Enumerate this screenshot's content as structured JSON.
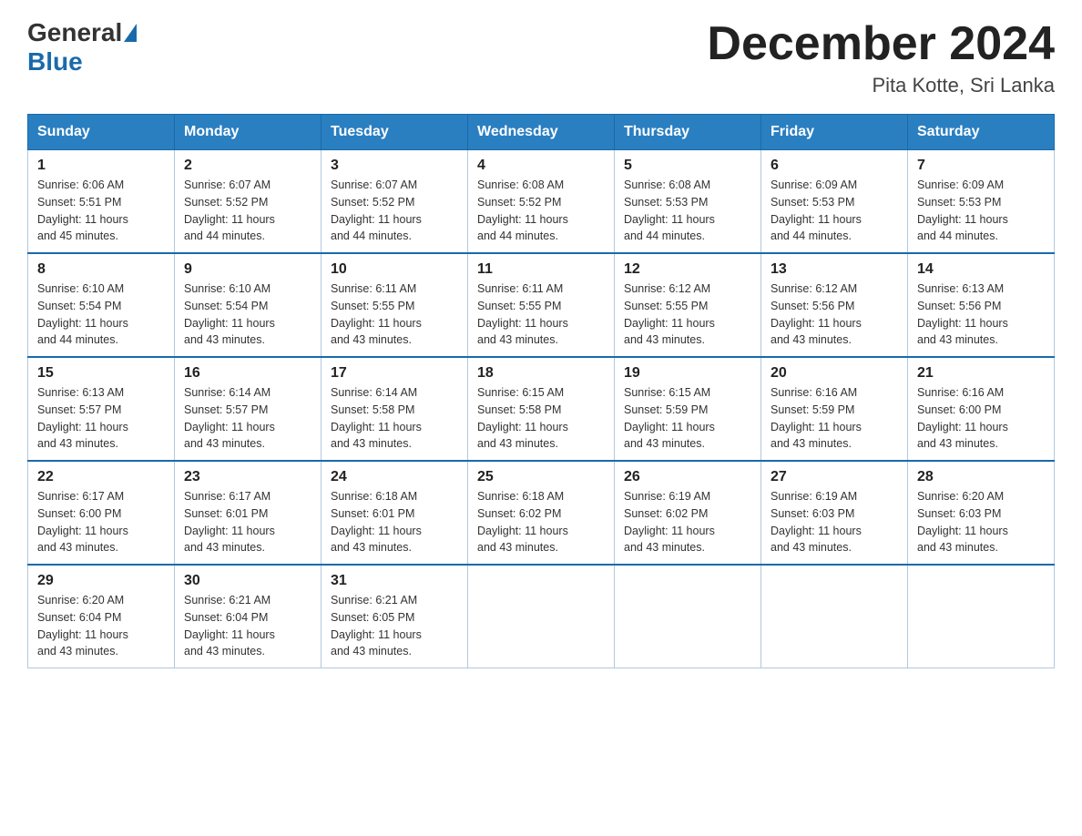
{
  "logo": {
    "general": "General",
    "blue": "Blue"
  },
  "title": "December 2024",
  "location": "Pita Kotte, Sri Lanka",
  "days_of_week": [
    "Sunday",
    "Monday",
    "Tuesday",
    "Wednesday",
    "Thursday",
    "Friday",
    "Saturday"
  ],
  "weeks": [
    [
      {
        "day": "1",
        "sunrise": "6:06 AM",
        "sunset": "5:51 PM",
        "daylight": "11 hours and 45 minutes."
      },
      {
        "day": "2",
        "sunrise": "6:07 AM",
        "sunset": "5:52 PM",
        "daylight": "11 hours and 44 minutes."
      },
      {
        "day": "3",
        "sunrise": "6:07 AM",
        "sunset": "5:52 PM",
        "daylight": "11 hours and 44 minutes."
      },
      {
        "day": "4",
        "sunrise": "6:08 AM",
        "sunset": "5:52 PM",
        "daylight": "11 hours and 44 minutes."
      },
      {
        "day": "5",
        "sunrise": "6:08 AM",
        "sunset": "5:53 PM",
        "daylight": "11 hours and 44 minutes."
      },
      {
        "day": "6",
        "sunrise": "6:09 AM",
        "sunset": "5:53 PM",
        "daylight": "11 hours and 44 minutes."
      },
      {
        "day": "7",
        "sunrise": "6:09 AM",
        "sunset": "5:53 PM",
        "daylight": "11 hours and 44 minutes."
      }
    ],
    [
      {
        "day": "8",
        "sunrise": "6:10 AM",
        "sunset": "5:54 PM",
        "daylight": "11 hours and 44 minutes."
      },
      {
        "day": "9",
        "sunrise": "6:10 AM",
        "sunset": "5:54 PM",
        "daylight": "11 hours and 43 minutes."
      },
      {
        "day": "10",
        "sunrise": "6:11 AM",
        "sunset": "5:55 PM",
        "daylight": "11 hours and 43 minutes."
      },
      {
        "day": "11",
        "sunrise": "6:11 AM",
        "sunset": "5:55 PM",
        "daylight": "11 hours and 43 minutes."
      },
      {
        "day": "12",
        "sunrise": "6:12 AM",
        "sunset": "5:55 PM",
        "daylight": "11 hours and 43 minutes."
      },
      {
        "day": "13",
        "sunrise": "6:12 AM",
        "sunset": "5:56 PM",
        "daylight": "11 hours and 43 minutes."
      },
      {
        "day": "14",
        "sunrise": "6:13 AM",
        "sunset": "5:56 PM",
        "daylight": "11 hours and 43 minutes."
      }
    ],
    [
      {
        "day": "15",
        "sunrise": "6:13 AM",
        "sunset": "5:57 PM",
        "daylight": "11 hours and 43 minutes."
      },
      {
        "day": "16",
        "sunrise": "6:14 AM",
        "sunset": "5:57 PM",
        "daylight": "11 hours and 43 minutes."
      },
      {
        "day": "17",
        "sunrise": "6:14 AM",
        "sunset": "5:58 PM",
        "daylight": "11 hours and 43 minutes."
      },
      {
        "day": "18",
        "sunrise": "6:15 AM",
        "sunset": "5:58 PM",
        "daylight": "11 hours and 43 minutes."
      },
      {
        "day": "19",
        "sunrise": "6:15 AM",
        "sunset": "5:59 PM",
        "daylight": "11 hours and 43 minutes."
      },
      {
        "day": "20",
        "sunrise": "6:16 AM",
        "sunset": "5:59 PM",
        "daylight": "11 hours and 43 minutes."
      },
      {
        "day": "21",
        "sunrise": "6:16 AM",
        "sunset": "6:00 PM",
        "daylight": "11 hours and 43 minutes."
      }
    ],
    [
      {
        "day": "22",
        "sunrise": "6:17 AM",
        "sunset": "6:00 PM",
        "daylight": "11 hours and 43 minutes."
      },
      {
        "day": "23",
        "sunrise": "6:17 AM",
        "sunset": "6:01 PM",
        "daylight": "11 hours and 43 minutes."
      },
      {
        "day": "24",
        "sunrise": "6:18 AM",
        "sunset": "6:01 PM",
        "daylight": "11 hours and 43 minutes."
      },
      {
        "day": "25",
        "sunrise": "6:18 AM",
        "sunset": "6:02 PM",
        "daylight": "11 hours and 43 minutes."
      },
      {
        "day": "26",
        "sunrise": "6:19 AM",
        "sunset": "6:02 PM",
        "daylight": "11 hours and 43 minutes."
      },
      {
        "day": "27",
        "sunrise": "6:19 AM",
        "sunset": "6:03 PM",
        "daylight": "11 hours and 43 minutes."
      },
      {
        "day": "28",
        "sunrise": "6:20 AM",
        "sunset": "6:03 PM",
        "daylight": "11 hours and 43 minutes."
      }
    ],
    [
      {
        "day": "29",
        "sunrise": "6:20 AM",
        "sunset": "6:04 PM",
        "daylight": "11 hours and 43 minutes."
      },
      {
        "day": "30",
        "sunrise": "6:21 AM",
        "sunset": "6:04 PM",
        "daylight": "11 hours and 43 minutes."
      },
      {
        "day": "31",
        "sunrise": "6:21 AM",
        "sunset": "6:05 PM",
        "daylight": "11 hours and 43 minutes."
      },
      null,
      null,
      null,
      null
    ]
  ],
  "labels": {
    "sunrise": "Sunrise:",
    "sunset": "Sunset:",
    "daylight": "Daylight:"
  }
}
